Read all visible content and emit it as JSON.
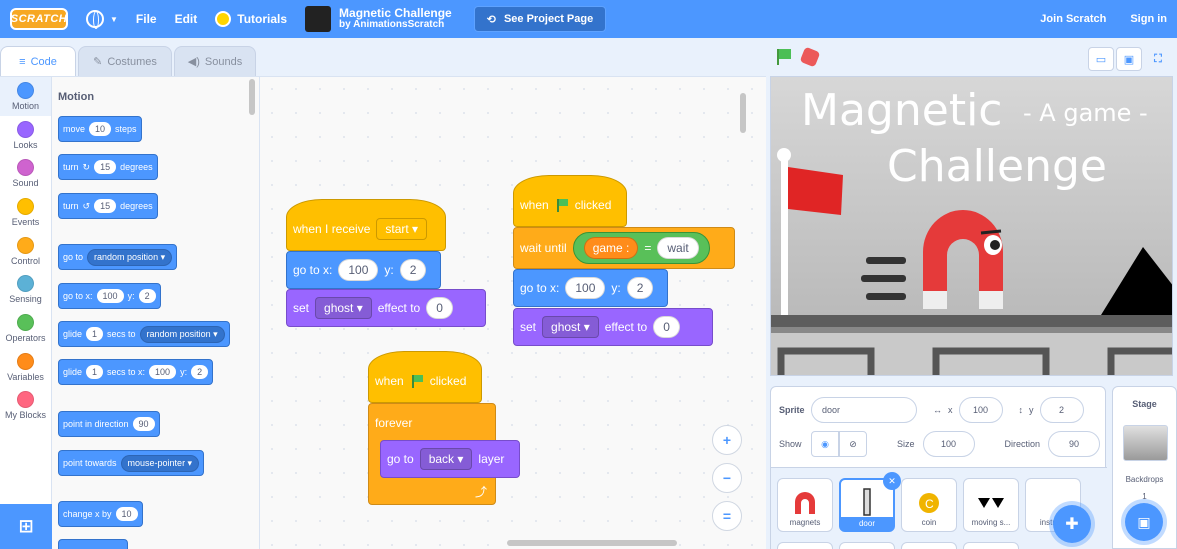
{
  "menubar": {
    "logo": "SCRATCH",
    "file": "File",
    "edit": "Edit",
    "tutorials": "Tutorials",
    "project_title": "Magnetic Challenge",
    "project_author": "by AnimationsScratch",
    "see_project": "See Project Page",
    "join": "Join Scratch",
    "signin": "Sign in"
  },
  "tabs": {
    "code": "Code",
    "costumes": "Costumes",
    "sounds": "Sounds"
  },
  "categories": [
    {
      "label": "Motion",
      "color": "#4c97ff"
    },
    {
      "label": "Looks",
      "color": "#9966ff"
    },
    {
      "label": "Sound",
      "color": "#cf63cf"
    },
    {
      "label": "Events",
      "color": "#ffbf00"
    },
    {
      "label": "Control",
      "color": "#ffab19"
    },
    {
      "label": "Sensing",
      "color": "#5cb1d6"
    },
    {
      "label": "Operators",
      "color": "#59c059"
    },
    {
      "label": "Variables",
      "color": "#ff8c1a"
    },
    {
      "label": "My Blocks",
      "color": "#ff6680"
    }
  ],
  "palette": {
    "title": "Motion",
    "move": {
      "pre": "move",
      "val": "10",
      "post": "steps"
    },
    "turn_right": {
      "pre": "turn",
      "icon": "↻",
      "val": "15",
      "post": "degrees"
    },
    "turn_left": {
      "pre": "turn",
      "icon": "↺",
      "val": "15",
      "post": "degrees"
    },
    "goto": {
      "pre": "go to",
      "drop": "random position ▾"
    },
    "gotoxy": {
      "pre": "go to x:",
      "x": "100",
      "ylabel": "y:",
      "y": "2"
    },
    "glide": {
      "pre": "glide",
      "val": "1",
      "mid": "secs to",
      "drop": "random position ▾"
    },
    "glidexy": {
      "pre": "glide",
      "val": "1",
      "mid": "secs to x:",
      "x": "100",
      "ylabel": "y:",
      "y": "2"
    },
    "point_dir": {
      "pre": "point in direction",
      "val": "90"
    },
    "point_towards": {
      "pre": "point towards",
      "drop": "mouse-pointer ▾"
    },
    "change_x": {
      "pre": "change x by",
      "val": "10"
    }
  },
  "scripts": {
    "s1": {
      "hat": "when I receive",
      "hat_drop": "start ▾",
      "goto": "go to x:",
      "x": "100",
      "ylabel": "y:",
      "y": "2",
      "set": "set",
      "effect_drop": "ghost ▾",
      "effect_to": "effect to",
      "effect_val": "0"
    },
    "s2": {
      "when": "when",
      "clicked": "clicked",
      "wait_until": "wait until",
      "var": "game :",
      "eq": "=",
      "val": "wait",
      "goto": "go to x:",
      "x": "100",
      "ylabel": "y:",
      "y": "2",
      "set": "set",
      "effect_drop": "ghost ▾",
      "effect_to": "effect to",
      "effect_val": "0"
    },
    "s3": {
      "when": "when",
      "clicked": "clicked",
      "forever": "forever",
      "goto": "go to",
      "layer_drop": "back ▾",
      "layer": "layer"
    }
  },
  "zoom": {
    "in": "+",
    "out": "−",
    "reset": "="
  },
  "stage": {
    "title_big": "Magnetic",
    "title_small": "- A game -",
    "title_2": "Challenge"
  },
  "sprite_info": {
    "sprite_label": "Sprite",
    "sprite_name": "door",
    "x_label": "x",
    "x_val": "100",
    "y_label": "y",
    "y_val": "2",
    "show_label": "Show",
    "size_label": "Size",
    "size_val": "100",
    "dir_label": "Direction",
    "dir_val": "90"
  },
  "sprites": [
    "magnets",
    "door",
    "coin",
    "moving s...",
    "instru..."
  ],
  "stage_target": {
    "title": "Stage",
    "backdrops": "Backdrops",
    "count": "1"
  }
}
